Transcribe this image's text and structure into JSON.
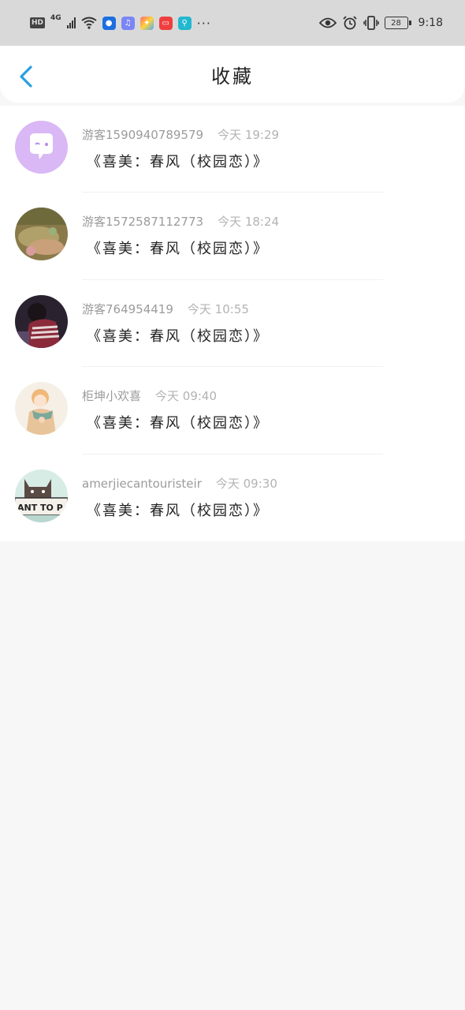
{
  "status_bar": {
    "hd": "HD",
    "network": "4G",
    "battery": "28",
    "time": "9:18",
    "more": "···"
  },
  "header": {
    "title": "收藏"
  },
  "favorites": [
    {
      "user": "游客1590940789579",
      "time": "今天 19:29",
      "title": "《喜美：春风（校园恋）》"
    },
    {
      "user": "游客1572587112773",
      "time": "今天 18:24",
      "title": "《喜美：春风（校园恋）》"
    },
    {
      "user": "游客764954419",
      "time": "今天 10:55",
      "title": "《喜美：春风（校园恋）》"
    },
    {
      "user": "柜坤小欢喜",
      "time": "今天 09:40",
      "title": "《喜美：春风（校园恋）》"
    },
    {
      "user": "amerjiecantouristeir",
      "time": "今天 09:30",
      "title": "《喜美：春风（校园恋）》"
    }
  ],
  "avatar_art": {
    "cat_sign": "ANT TO P"
  },
  "colors": {
    "accent": "#2a9fe0",
    "status_bar_bg": "#d9d9d9",
    "page_bg": "#f8f7f7"
  }
}
